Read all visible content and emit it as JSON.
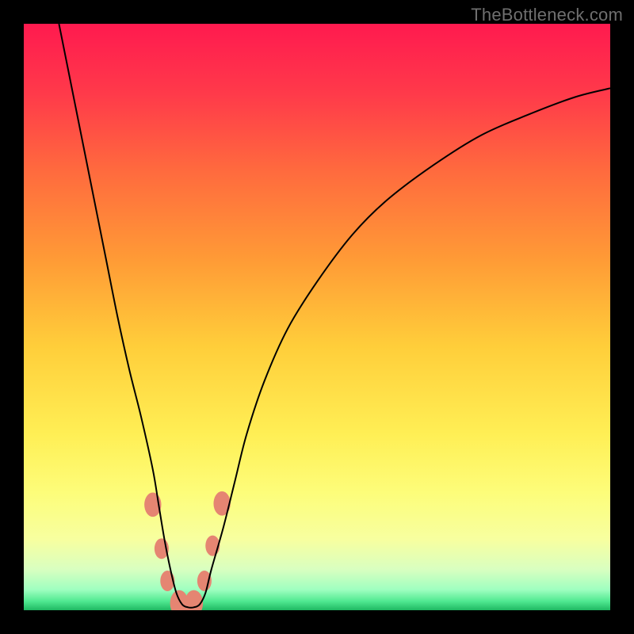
{
  "watermark": {
    "text": "TheBottleneck.com"
  },
  "chart_data": {
    "type": "line",
    "title": "",
    "xlabel": "",
    "ylabel": "",
    "xlim": [
      0,
      100
    ],
    "ylim": [
      0,
      100
    ],
    "grid": false,
    "background_gradient": {
      "stops": [
        {
          "pos": 0.0,
          "color": "#ff1a4f"
        },
        {
          "pos": 0.12,
          "color": "#ff3a4a"
        },
        {
          "pos": 0.25,
          "color": "#ff6a3e"
        },
        {
          "pos": 0.4,
          "color": "#ff9a36"
        },
        {
          "pos": 0.55,
          "color": "#ffce3a"
        },
        {
          "pos": 0.7,
          "color": "#ffef55"
        },
        {
          "pos": 0.8,
          "color": "#fdfd7a"
        },
        {
          "pos": 0.88,
          "color": "#f7ffa0"
        },
        {
          "pos": 0.93,
          "color": "#d9ffc0"
        },
        {
          "pos": 0.965,
          "color": "#9fffc0"
        },
        {
          "pos": 0.985,
          "color": "#4fe890"
        },
        {
          "pos": 1.0,
          "color": "#1fb862"
        }
      ]
    },
    "series": [
      {
        "name": "bottleneck-curve",
        "color": "#000000",
        "x": [
          6,
          8,
          10,
          12,
          14,
          16,
          18,
          20,
          22,
          23,
          24,
          25,
          26,
          27,
          28,
          29,
          30,
          31,
          32,
          34,
          36,
          38,
          41,
          45,
          50,
          56,
          62,
          70,
          78,
          86,
          94,
          100
        ],
        "values": [
          100,
          90,
          80,
          70,
          60,
          50,
          41,
          33,
          24,
          18,
          12,
          7,
          3,
          1,
          0.5,
          0.5,
          1,
          3,
          7,
          14,
          22,
          30,
          39,
          48,
          56,
          64,
          70,
          76,
          81,
          84.5,
          87.5,
          89
        ]
      }
    ],
    "markers": [
      {
        "x": 22.0,
        "y": 18.0,
        "color": "#e58572",
        "r": 13
      },
      {
        "x": 23.5,
        "y": 10.5,
        "color": "#e58572",
        "r": 11
      },
      {
        "x": 24.5,
        "y": 5.0,
        "color": "#e58572",
        "r": 11
      },
      {
        "x": 26.5,
        "y": 1.2,
        "color": "#e58572",
        "r": 14
      },
      {
        "x": 29.0,
        "y": 1.2,
        "color": "#e58572",
        "r": 14
      },
      {
        "x": 30.8,
        "y": 5.0,
        "color": "#e58572",
        "r": 11
      },
      {
        "x": 32.2,
        "y": 11.0,
        "color": "#e58572",
        "r": 11
      },
      {
        "x": 33.8,
        "y": 18.2,
        "color": "#e58572",
        "r": 13
      }
    ]
  }
}
